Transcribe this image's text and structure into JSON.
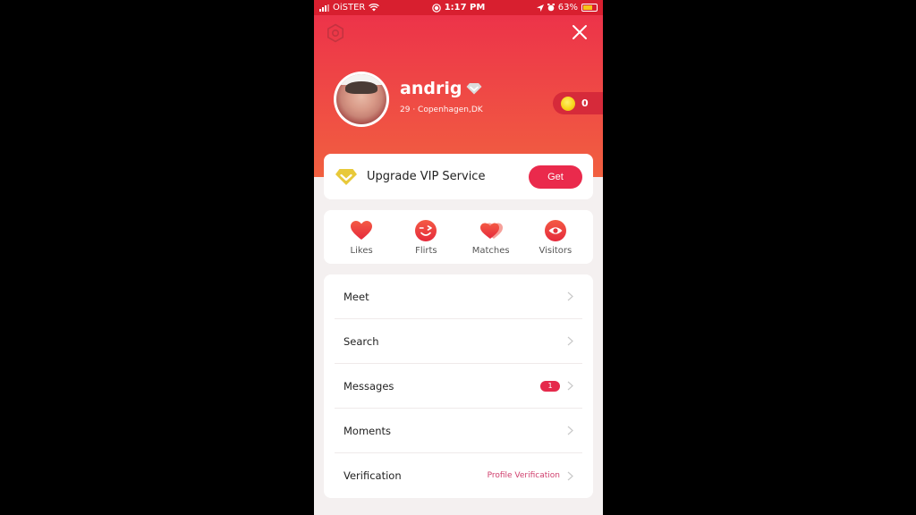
{
  "status_bar": {
    "carrier": "OiSTER",
    "time": "1:17 PM",
    "battery": "63%"
  },
  "profile": {
    "username": "andrig",
    "location": "29 · Copenhagen,DK",
    "coins": "0"
  },
  "vip": {
    "label": "Upgrade VIP Service",
    "button": "Get"
  },
  "quick_actions": [
    {
      "label": "Likes",
      "icon": "heart-icon"
    },
    {
      "label": "Flirts",
      "icon": "wink-face-icon"
    },
    {
      "label": "Matches",
      "icon": "double-heart-icon"
    },
    {
      "label": "Visitors",
      "icon": "eye-icon"
    }
  ],
  "menu": [
    {
      "label": "Meet",
      "value": null,
      "badge": null
    },
    {
      "label": "Search",
      "value": null,
      "badge": null
    },
    {
      "label": "Messages",
      "value": null,
      "badge": "1"
    },
    {
      "label": "Moments",
      "value": null,
      "badge": null
    },
    {
      "label": "Verification",
      "value": "Profile Verification",
      "badge": null
    }
  ],
  "colors": {
    "accent": "#ea2a4c",
    "header_top": "#ec2f4a",
    "header_bottom": "#f16040",
    "vip_gold": "#e8c93a",
    "link_pink": "#d0406e"
  }
}
